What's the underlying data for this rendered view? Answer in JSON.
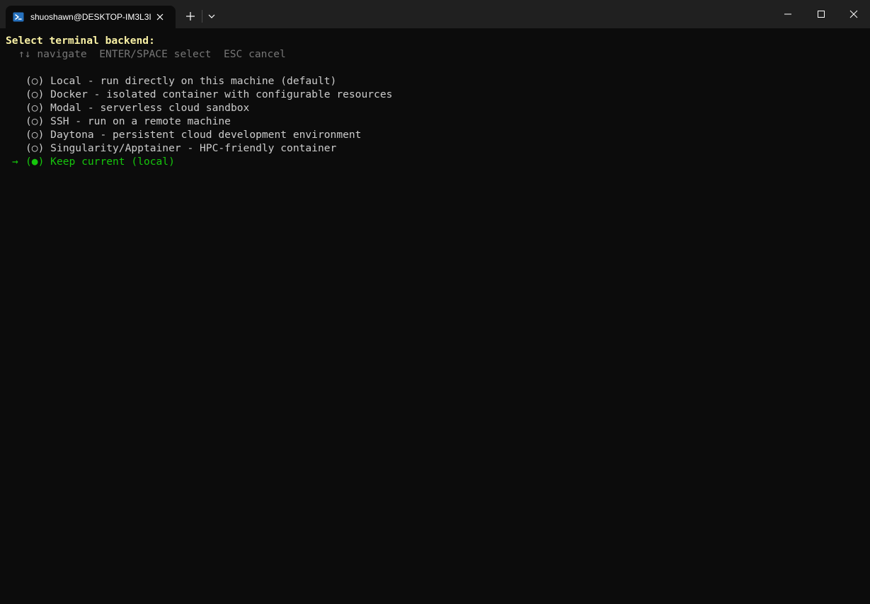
{
  "window": {
    "tab_title": "shuoshawn@DESKTOP-IM3L3I",
    "icons": {
      "tab": "powershell-icon",
      "close": "close-icon",
      "new_tab": "plus-icon",
      "dropdown": "chevron-down-icon",
      "minimize": "minimize-icon",
      "maximize": "maximize-icon",
      "window_close": "window-close-icon"
    }
  },
  "terminal": {
    "prompt": "Select terminal backend:",
    "hints": {
      "navigate": "↑↓ navigate",
      "select": "ENTER/SPACE select",
      "cancel": "ESC cancel"
    },
    "pointer": "→",
    "options": [
      {
        "marker": "(○)",
        "label": "Local - run directly on this machine (default)"
      },
      {
        "marker": "(○)",
        "label": "Docker - isolated container with configurable resources"
      },
      {
        "marker": "(○)",
        "label": "Modal - serverless cloud sandbox"
      },
      {
        "marker": "(○)",
        "label": "SSH - run on a remote machine"
      },
      {
        "marker": "(○)",
        "label": "Daytona - persistent cloud development environment"
      },
      {
        "marker": "(○)",
        "label": "Singularity/Apptainer - HPC-friendly container"
      },
      {
        "marker": "(●)",
        "label": "Keep current (local)"
      }
    ],
    "selected_index": 6
  },
  "colors": {
    "background": "#0c0c0c",
    "titlebar": "#202020",
    "prompt": "#f9f1a5",
    "hint": "#767676",
    "text": "#cccccc",
    "selected": "#16c60c"
  }
}
